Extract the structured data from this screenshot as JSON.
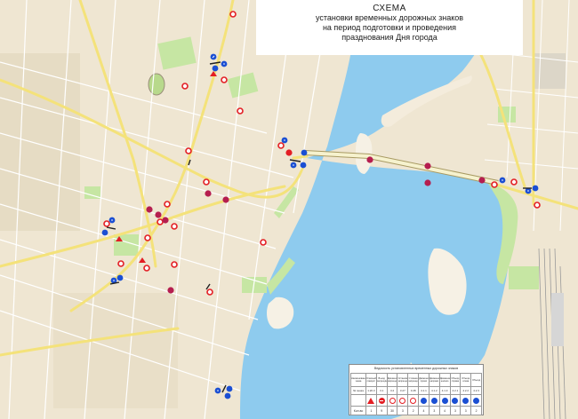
{
  "title": {
    "line1": "СХЕМА",
    "line2": "установки временных дорожных знаков",
    "line3": "на период подготовки и проведения",
    "line4": "празднования Дня города"
  },
  "legend": {
    "title": "Ведомость установленных временных дорожных знаков",
    "header_cells": [
      "Наименование знака",
      "Опасный поворот",
      "Въезд запрещён",
      "Движение запрещено",
      "Остановка запрещена",
      "Стоянка запрещена",
      "Движение прямо",
      "Движение направо",
      "Движение налево",
      "Объезд справа",
      "Объезд слева",
      "Объезд"
    ],
    "codes": [
      "№ знака",
      "1.20.3",
      "3.1",
      "3.2",
      "3.27",
      "3.28",
      "4.1.1",
      "4.1.2",
      "4.1.3",
      "4.2.1",
      "4.2.2",
      "4.2.3"
    ],
    "qty_label": "Кол-во",
    "quantities": [
      "",
      "1",
      "9",
      "30",
      "3",
      "2",
      "4",
      "3",
      "4",
      "3",
      "3",
      "2"
    ]
  },
  "colors": {
    "land": "#efe6d2",
    "water": "#8ecbee",
    "park": "#c6e6a3",
    "road_major": "#f7eb8f",
    "road_minor": "#ffffff",
    "sign_red": "#e31e24",
    "sign_blue": "#1b4fd3",
    "bridge": "#f6f2ce"
  },
  "icons": {
    "prohibition_sign": "red-ring-circle",
    "no_entry_sign": "red-disc-white-bar",
    "mandatory_sign": "blue-disc-white-arrow",
    "warning_sign": "red-triangle"
  }
}
